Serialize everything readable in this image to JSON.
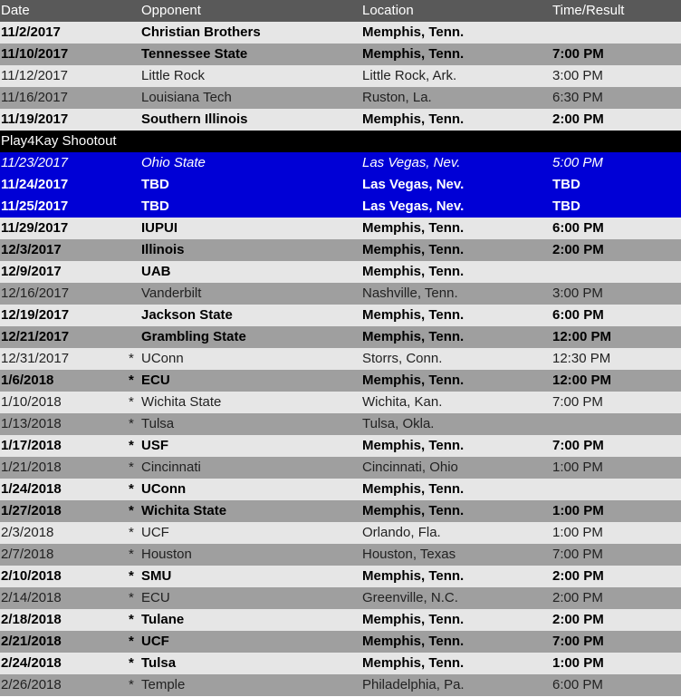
{
  "header": {
    "date": "Date",
    "opponent": "Opponent",
    "location": "Location",
    "time_result": "Time/Result"
  },
  "colors": {
    "header_bg": "#595959",
    "row_light": "#e6e6e6",
    "row_dark": "#9f9f9f",
    "section_bg": "#000000",
    "tournament_bg": "#0000d6"
  },
  "rows": [
    {
      "date": "11/2/2017",
      "star": "",
      "opponent": "Christian Brothers",
      "location": "Memphis, Tenn.",
      "time": "",
      "home": true,
      "shade": "light"
    },
    {
      "date": "11/10/2017",
      "star": "",
      "opponent": "Tennessee State",
      "location": "Memphis, Tenn.",
      "time": "7:00 PM",
      "home": true,
      "shade": "dark"
    },
    {
      "date": "11/12/2017",
      "star": "",
      "opponent": "Little Rock",
      "location": "Little Rock, Ark.",
      "time": "3:00 PM",
      "home": false,
      "shade": "light"
    },
    {
      "date": "11/16/2017",
      "star": "",
      "opponent": "Louisiana Tech",
      "location": "Ruston, La.",
      "time": "6:30 PM",
      "home": false,
      "shade": "dark"
    },
    {
      "date": "11/19/2017",
      "star": "",
      "opponent": "Southern Illinois",
      "location": "Memphis, Tenn.",
      "time": "2:00 PM",
      "home": true,
      "shade": "light"
    },
    {
      "section": "Play4Kay Shootout"
    },
    {
      "date": "11/23/2017",
      "star": "",
      "opponent": "Ohio State",
      "location": "Las Vegas, Nev.",
      "time": "5:00 PM",
      "home": false,
      "shade": "blue"
    },
    {
      "date": "11/24/2017",
      "star": "",
      "opponent": "TBD",
      "location": "Las Vegas, Nev.",
      "time": "TBD",
      "home": true,
      "shade": "blue"
    },
    {
      "date": "11/25/2017",
      "star": "",
      "opponent": "TBD",
      "location": "Las Vegas, Nev.",
      "time": "TBD",
      "home": true,
      "shade": "blue"
    },
    {
      "date": "11/29/2017",
      "star": "",
      "opponent": "IUPUI",
      "location": "Memphis, Tenn.",
      "time": "6:00 PM",
      "home": true,
      "shade": "light"
    },
    {
      "date": "12/3/2017",
      "star": "",
      "opponent": "Illinois",
      "location": "Memphis, Tenn.",
      "time": "2:00 PM",
      "home": true,
      "shade": "dark"
    },
    {
      "date": "12/9/2017",
      "star": "",
      "opponent": "UAB",
      "location": "Memphis, Tenn.",
      "time": "",
      "home": true,
      "shade": "light"
    },
    {
      "date": "12/16/2017",
      "star": "",
      "opponent": "Vanderbilt",
      "location": "Nashville, Tenn.",
      "time": "3:00 PM",
      "home": false,
      "shade": "dark"
    },
    {
      "date": "12/19/2017",
      "star": "",
      "opponent": "Jackson State",
      "location": "Memphis, Tenn.",
      "time": "6:00 PM",
      "home": true,
      "shade": "light"
    },
    {
      "date": "12/21/2017",
      "star": "",
      "opponent": "Grambling State",
      "location": "Memphis, Tenn.",
      "time": "12:00 PM",
      "home": true,
      "shade": "dark"
    },
    {
      "date": "12/31/2017",
      "star": "*",
      "opponent": "UConn",
      "location": "Storrs, Conn.",
      "time": "12:30 PM",
      "home": false,
      "shade": "light"
    },
    {
      "date": "1/6/2018",
      "star": "*",
      "opponent": "ECU",
      "location": "Memphis, Tenn.",
      "time": "12:00 PM",
      "home": true,
      "shade": "dark"
    },
    {
      "date": "1/10/2018",
      "star": "*",
      "opponent": "Wichita State",
      "location": "Wichita, Kan.",
      "time": "7:00 PM",
      "home": false,
      "shade": "light"
    },
    {
      "date": "1/13/2018",
      "star": "*",
      "opponent": "Tulsa",
      "location": "Tulsa, Okla.",
      "time": "",
      "home": false,
      "shade": "dark"
    },
    {
      "date": "1/17/2018",
      "star": "*",
      "opponent": "USF",
      "location": "Memphis, Tenn.",
      "time": "7:00 PM",
      "home": true,
      "shade": "light"
    },
    {
      "date": "1/21/2018",
      "star": "*",
      "opponent": "Cincinnati",
      "location": "Cincinnati, Ohio",
      "time": "1:00 PM",
      "home": false,
      "shade": "dark"
    },
    {
      "date": "1/24/2018",
      "star": "*",
      "opponent": "UConn",
      "location": "Memphis, Tenn.",
      "time": "",
      "home": true,
      "shade": "light"
    },
    {
      "date": "1/27/2018",
      "star": "*",
      "opponent": "Wichita State",
      "location": "Memphis, Tenn.",
      "time": "1:00 PM",
      "home": true,
      "shade": "dark"
    },
    {
      "date": "2/3/2018",
      "star": "*",
      "opponent": "UCF",
      "location": "Orlando, Fla.",
      "time": "1:00 PM",
      "home": false,
      "shade": "light"
    },
    {
      "date": "2/7/2018",
      "star": "*",
      "opponent": "Houston",
      "location": "Houston, Texas",
      "time": "7:00 PM",
      "home": false,
      "shade": "dark"
    },
    {
      "date": "2/10/2018",
      "star": "*",
      "opponent": "SMU",
      "location": "Memphis, Tenn.",
      "time": "2:00 PM",
      "home": true,
      "shade": "light"
    },
    {
      "date": "2/14/2018",
      "star": "*",
      "opponent": "ECU",
      "location": "Greenville, N.C.",
      "time": "2:00 PM",
      "home": false,
      "shade": "dark"
    },
    {
      "date": "2/18/2018",
      "star": "*",
      "opponent": "Tulane",
      "location": "Memphis, Tenn.",
      "time": "2:00 PM",
      "home": true,
      "shade": "light"
    },
    {
      "date": "2/21/2018",
      "star": "*",
      "opponent": "UCF",
      "location": "Memphis, Tenn.",
      "time": "7:00 PM",
      "home": true,
      "shade": "dark"
    },
    {
      "date": "2/24/2018",
      "star": "*",
      "opponent": "Tulsa",
      "location": "Memphis, Tenn.",
      "time": "1:00 PM",
      "home": true,
      "shade": "light"
    },
    {
      "date": "2/26/2018",
      "star": "*",
      "opponent": "Temple",
      "location": "Philadelphia, Pa.",
      "time": "6:00 PM",
      "home": false,
      "shade": "dark"
    }
  ]
}
